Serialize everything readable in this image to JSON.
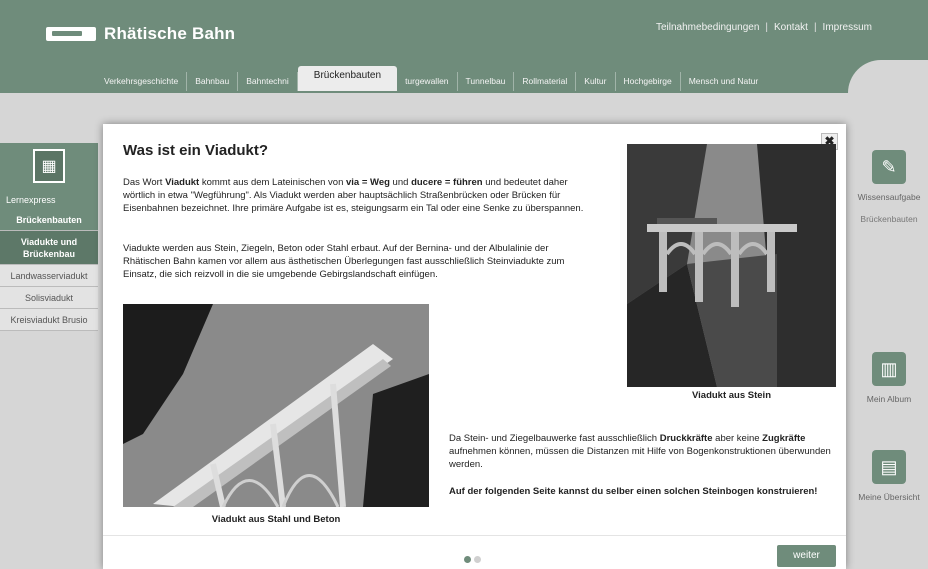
{
  "header": {
    "logo_text": "Rhätische Bahn",
    "links": [
      "Teilnahmebedingungen",
      "Kontakt",
      "Impressum"
    ],
    "link_separator": "|"
  },
  "nav": {
    "items": [
      "Verkehrsgeschichte",
      "Bahnbau",
      "Bahntechni",
      "Brückenbauten",
      "turgewallen",
      "Tunnelbau",
      "Rollmaterial",
      "Kultur",
      "Hochgebirge",
      "Mensch und Natur"
    ],
    "active_index": 3
  },
  "left_panel": {
    "lernexpress": "Lernexpress",
    "brueckenbauten": "Brückenbauten",
    "viadukte_line1": "Viadukte und",
    "viadukte_line2": "Brückenbau",
    "items": [
      "Landwasserviadukt",
      "Solisviadukt",
      "Kreisviadukt Brusio"
    ]
  },
  "right_panel": {
    "wissensaufgabe": "Wissensaufgabe",
    "brueckenbauten": "Brückenbauten",
    "album": "Mein Album",
    "uebersicht": "Meine Übersicht"
  },
  "modal": {
    "title": "Was ist ein Viadukt?",
    "close": "✖",
    "p1_a": "Das Wort ",
    "p1_b": "Viadukt",
    "p1_c": " kommt aus dem Lateinischen von ",
    "p1_d": "via = Weg",
    "p1_e": " und ",
    "p1_f": "ducere = führen",
    "p1_g": " und bedeutet daher wörtlich in etwa \"Wegführung\". Als Viadukt werden aber hauptsächlich Straßenbrücken oder Brücken für Eisenbahnen bezeichnet. Ihre primäre Aufgabe ist es, steigungsarm ein Tal oder eine Senke zu überspannen.",
    "p2": "Viadukte werden aus Stein, Ziegeln, Beton oder Stahl erbaut. Auf der Bernina- und der Albulalinie der Rhätischen Bahn kamen vor allem aus ästhetischen Überlegungen fast ausschließlich Steinviadukte zum Einsatz, die sich reizvoll in die sie umgebende Gebirgslandschaft einfügen.",
    "caption_stein": "Viadukt aus Stein",
    "caption_stahl": "Viadukt aus Stahl und Beton",
    "p3_a": "Da Stein- und Ziegelbauwerke fast ausschließlich ",
    "p3_b": "Druckkräfte",
    "p3_c": " aber keine ",
    "p3_d": "Zugkräfte",
    "p3_e": " aufnehmen können, müssen die Distanzen mit Hilfe von Bogenkonstruktionen überwunden werden.",
    "p4": "Auf der folgenden Seite kannst du selber einen solchen Steinbogen konstruieren!",
    "next_button": "weiter"
  }
}
